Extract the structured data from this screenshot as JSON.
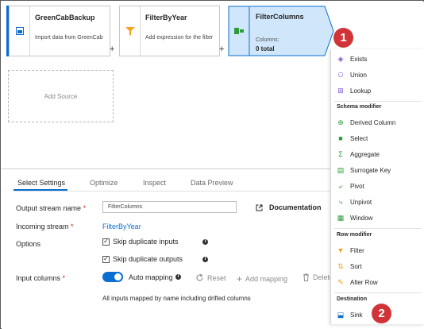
{
  "canvas": {
    "nodes": [
      {
        "title": "GreenCabBackup",
        "description": "Import data from GreenCab"
      },
      {
        "title": "FilterByYear",
        "description": "Add expression for the filter"
      },
      {
        "title": "FilterColumns",
        "columns_label": "Columns:",
        "columns_value": "0 total"
      }
    ],
    "plus": "+",
    "add_source": "Add Source"
  },
  "tabs": [
    "Select Settings",
    "Optimize",
    "Inspect",
    "Data Preview"
  ],
  "settings": {
    "output_stream_label": "Output stream name",
    "output_stream_value": "FilterColumns",
    "incoming_stream_label": "Incoming stream",
    "incoming_stream_value": "FilterByYear",
    "options_label": "Options",
    "skip_duplicate_inputs": "Skip duplicate inputs",
    "skip_duplicate_outputs": "Skip duplicate outputs",
    "input_columns_label": "Input columns",
    "auto_mapping": "Auto mapping",
    "reset": "Reset",
    "add_mapping": "Add mapping",
    "delete": "Delete",
    "mapping_note": "All inputs mapped by name including drifted columns",
    "documentation": "Documentation",
    "required_mark": "*"
  },
  "menu": {
    "items_top": [
      "Exists",
      "Union",
      "Lookup"
    ],
    "schema_header": "Schema modifier",
    "schema_items": [
      "Derived Column",
      "Select",
      "Aggregate",
      "Surrogate Key",
      "Pivot",
      "Unpivot",
      "Window"
    ],
    "row_header": "Row modifier",
    "row_items": [
      "Filter",
      "Sort",
      "Alter Row"
    ],
    "destination_header": "Destination",
    "destination_items": [
      "Sink"
    ]
  },
  "badges": [
    "1",
    "2"
  ],
  "colors": {
    "accent": "#0a6ed1",
    "selected_node_bg": "#cfe6fb",
    "badge": "#d13438"
  }
}
